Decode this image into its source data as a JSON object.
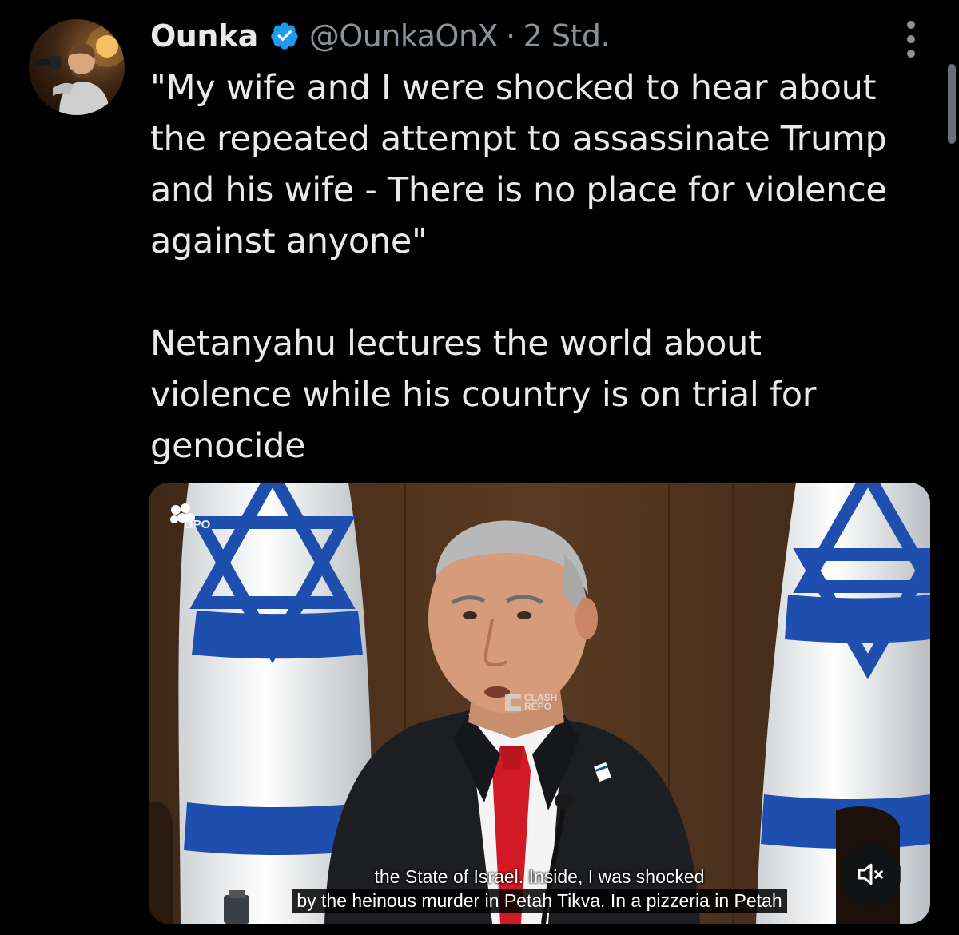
{
  "author": {
    "display_name": "Ounka",
    "verified": true,
    "handle": "@OunkaOnX",
    "separator": "·",
    "time": "2 Std."
  },
  "tweet": {
    "paragraphs": [
      "\"My wife and I were shocked to hear about\nthe repeated attempt to assassinate Trump\nand his wife - There is no place for violence\nagainst anyone\"",
      "Netanyahu lectures the world about\nviolence while his country is on trial for\ngenocide"
    ]
  },
  "media": {
    "type": "video",
    "channel_logo_text": "GPO",
    "watermark_text": "CLASH\nREPO",
    "subtitles": [
      "the State of Israel.  Inside, I was shocked",
      "by the heinous murder in Petah Tikva. In a pizzeria in Petah"
    ],
    "muted": true
  },
  "icons": {
    "verified": "verified-badge-icon",
    "more": "more-options-icon",
    "mute": "speaker-muted-icon"
  },
  "colors": {
    "background": "#000000",
    "text_primary": "#e7e9ea",
    "text_secondary": "#8b9198",
    "verified_blue": "#1d9bf0",
    "flag_blue": "#1f4fae"
  }
}
